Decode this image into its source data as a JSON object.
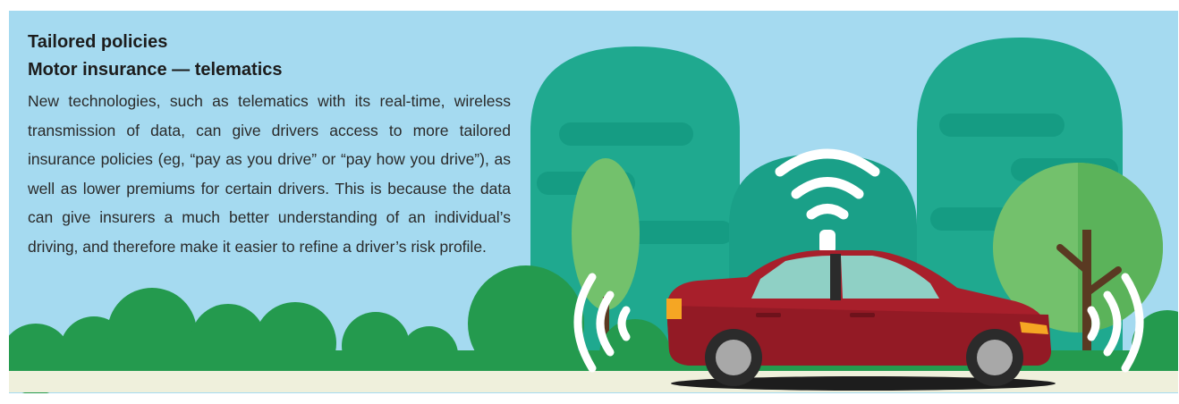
{
  "heading": "Tailored policies",
  "subheading": "Motor insurance — telematics",
  "body": "New technologies, such as telematics with its real-time, wireless transmission of data, can give drivers access to more tailored insurance policies (eg, “pay as you drive” or “pay how you drive”), as well as lower premiums for certain drivers. This is because the data can give insurers a much better understanding of an individual’s driving, and therefore make it easier to refine a driver’s risk profile.",
  "colors": {
    "sky": "#a5daf0",
    "teal_tree": "#1fa98f",
    "green_bush": "#249a4e",
    "light_green_tree": "#73c16c",
    "road": "#eff0dc",
    "ground_strip": "#4aa94a",
    "car_body": "#a81f2b",
    "signal_white": "#ffffff"
  },
  "icons": [
    "wifi-signal-icon",
    "car-icon",
    "tree-icon"
  ]
}
